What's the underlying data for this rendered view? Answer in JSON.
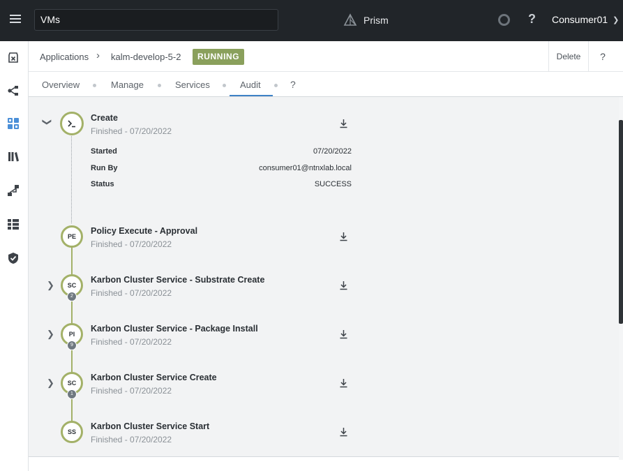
{
  "topbar": {
    "search_value": "VMs",
    "brand": "Prism",
    "help": "?",
    "user": "Consumer01"
  },
  "rail": {
    "icons": [
      "clear-icon",
      "blueprint-icon",
      "applications-icon",
      "library-icon",
      "runbook-icon",
      "endpoints-icon",
      "policies-icon"
    ],
    "active_color": "#4a8fd8",
    "icon_color": "#3d4248"
  },
  "header": {
    "breadcrumb_root": "Applications",
    "separator": "›",
    "app_name": "kalm-develop-5-2",
    "status": "RUNNING",
    "status_color": "#8aa05c",
    "delete_label": "Delete",
    "help": "?"
  },
  "tabs": {
    "items": [
      "Overview",
      "Manage",
      "Services",
      "Audit"
    ],
    "active": "Audit",
    "help": "?"
  },
  "audit": {
    "create": {
      "title": "Create",
      "subtitle": "Finished - 07/20/2022",
      "details": {
        "started_label": "Started",
        "started_value": "07/20/2022",
        "runby_label": "Run By",
        "runby_value": "consumer01@ntnxlab.local",
        "status_label": "Status",
        "status_value": "SUCCESS"
      }
    },
    "steps": [
      {
        "initials": "PE",
        "title": "Policy Execute - Approval",
        "subtitle": "Finished - 07/20/2022"
      },
      {
        "initials": "SC",
        "badge": "2",
        "title": "Karbon Cluster Service - Substrate Create",
        "subtitle": "Finished - 07/20/2022"
      },
      {
        "initials": "PI",
        "badge": "9",
        "title": "Karbon Cluster Service - Package Install",
        "subtitle": "Finished - 07/20/2022"
      },
      {
        "initials": "SC",
        "badge": "1",
        "title": "Karbon Cluster Service Create",
        "subtitle": "Finished - 07/20/2022"
      },
      {
        "initials": "SS",
        "title": "Karbon Cluster Service Start",
        "subtitle": "Finished - 07/20/2022"
      }
    ],
    "node_color": "#a3b168"
  }
}
